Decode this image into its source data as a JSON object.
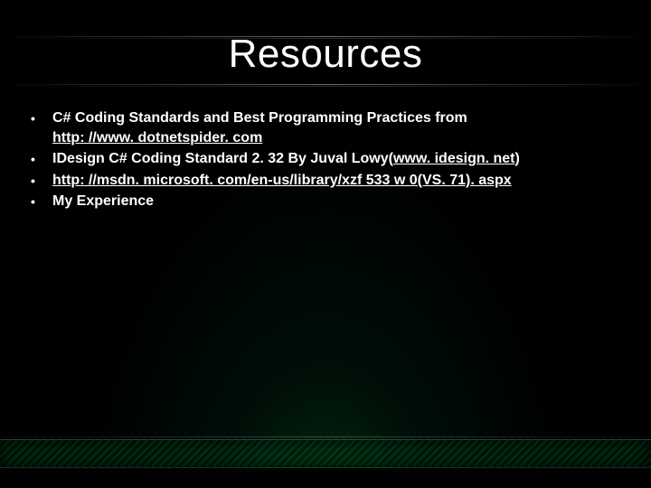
{
  "title": "Resources",
  "bullets": [
    {
      "before": "C# Coding Standards and Best Programming Practices from ",
      "link": "http: //www. dotnetspider. com",
      "after": "",
      "link_block": true
    },
    {
      "before": "IDesign C# Coding Standard 2. 32 By Juval Lowy(",
      "link": "www. idesign. net",
      "after": ")",
      "link_block": false
    },
    {
      "before": "",
      "link": "http: //msdn. microsoft. com/en-us/library/xzf 533 w 0(VS. 71). aspx",
      "after": "",
      "link_block": false
    },
    {
      "before": "My Experience",
      "link": "",
      "after": "",
      "link_block": false
    }
  ],
  "glyphs": {
    "bullet": "•"
  }
}
